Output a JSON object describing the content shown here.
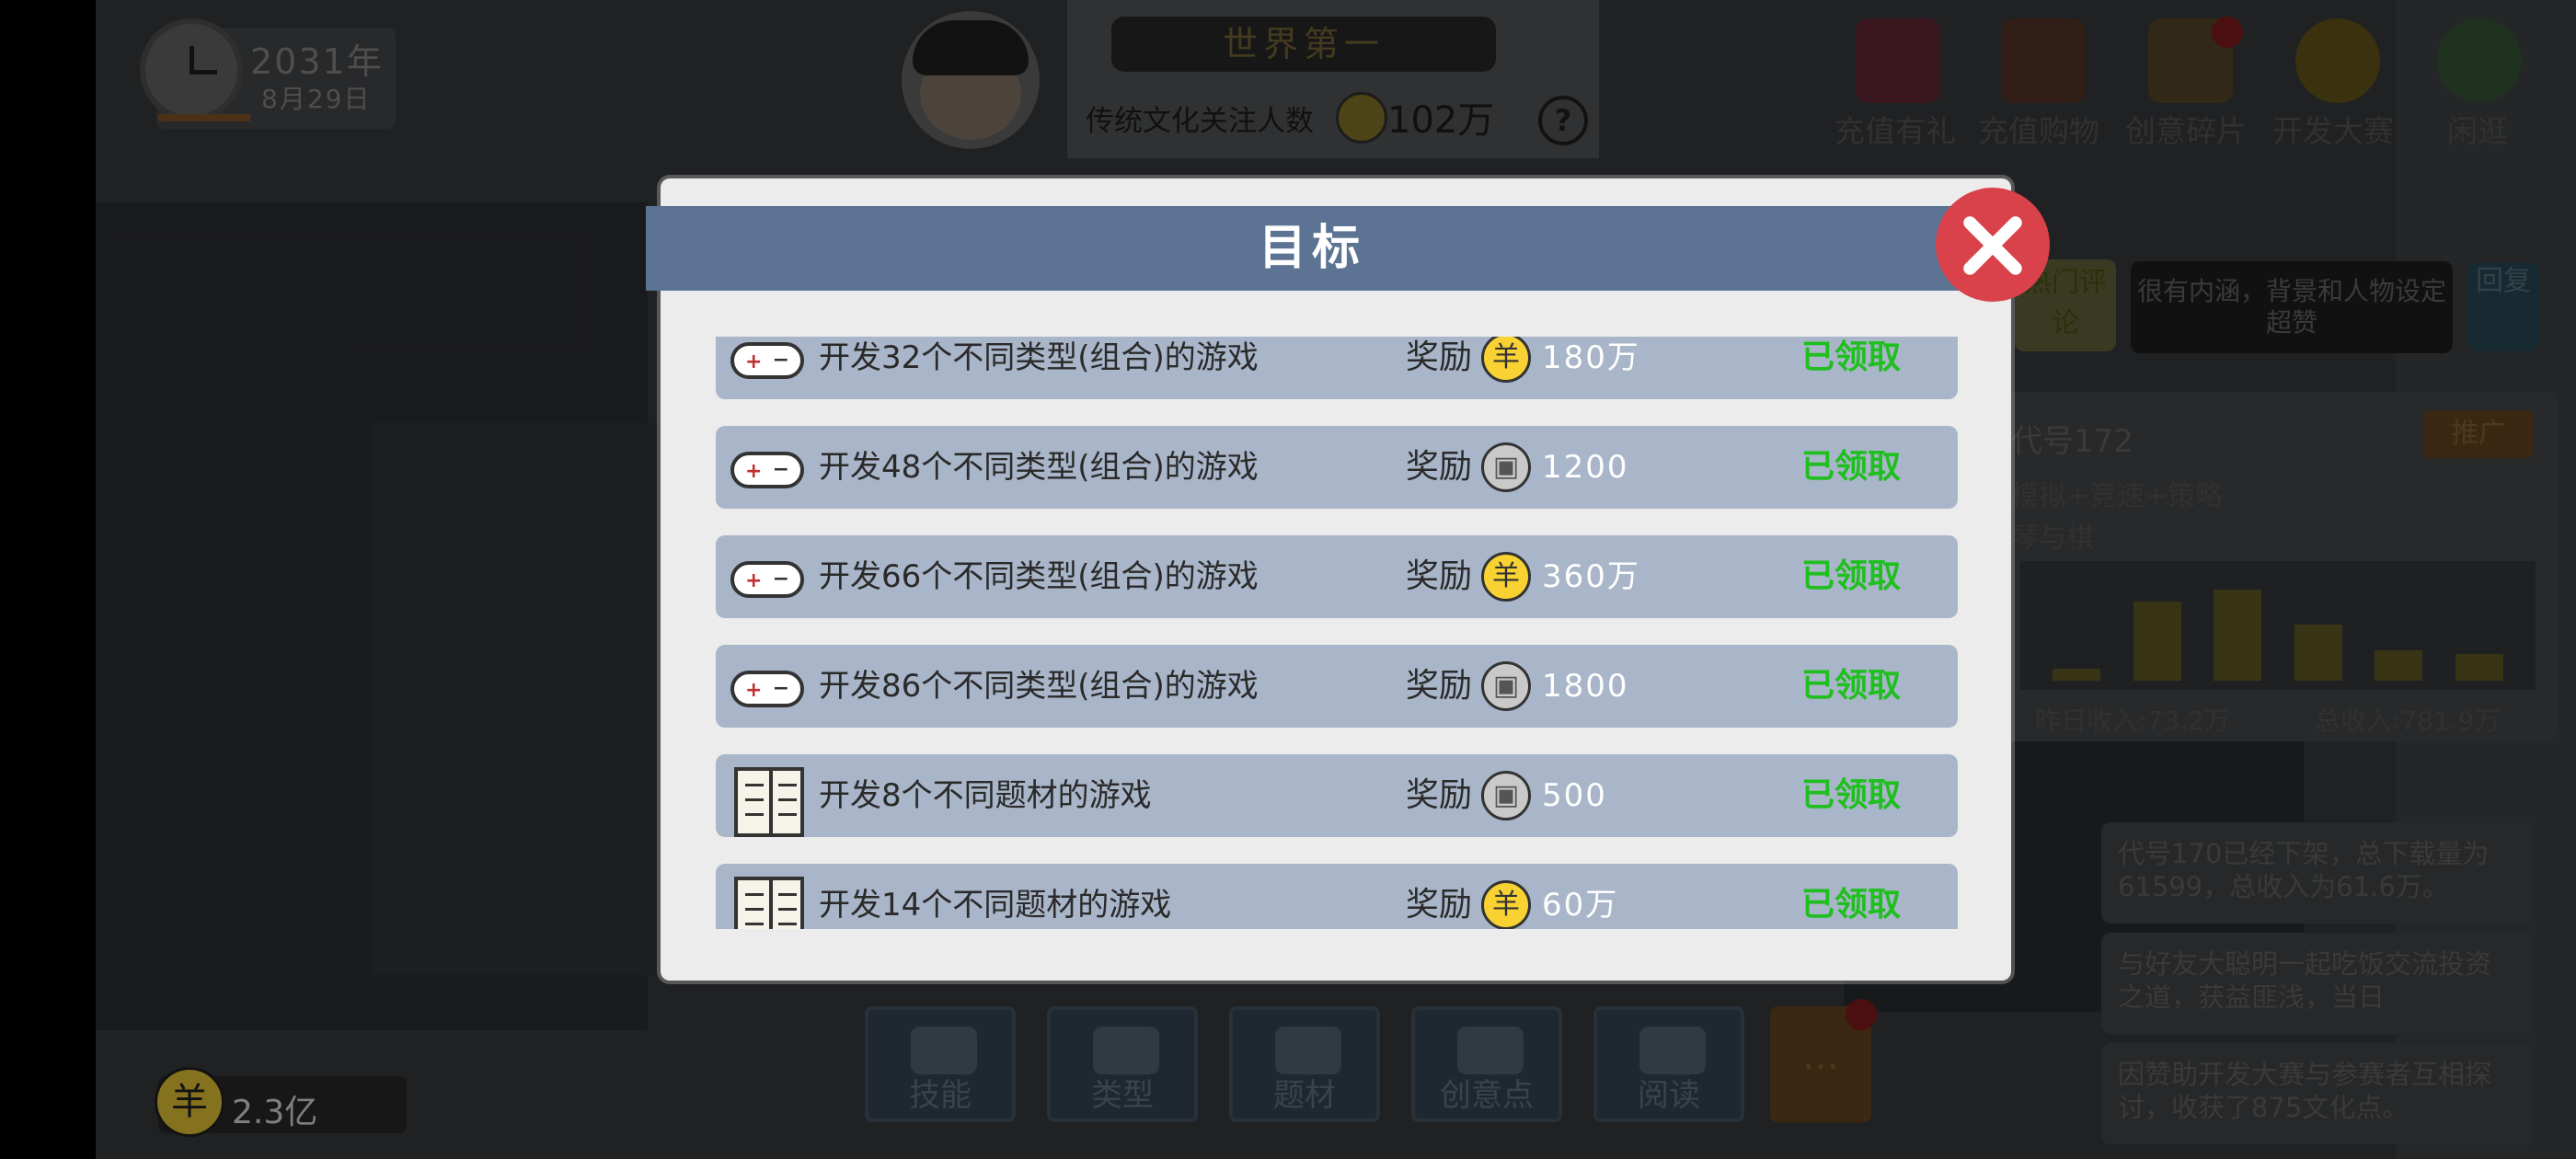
{
  "hud": {
    "year": "2031年",
    "day": "8月29日",
    "rank_title": "世界第一",
    "fans_label": "传统文化关注人数",
    "fans_count": "102万",
    "help": "?"
  },
  "top_menu": [
    {
      "label": "充值有礼",
      "icon": "gift-icon"
    },
    {
      "label": "充值购物",
      "icon": "shop-icon"
    },
    {
      "label": "创意碎片",
      "icon": "gift-box-icon"
    },
    {
      "label": "开发大赛",
      "icon": "code-medal-icon"
    },
    {
      "label": "闲逛",
      "icon": "tree-icon"
    }
  ],
  "hot_comment": {
    "tag": "热门评论",
    "text": "很有内涵，背景和人物设定超赞",
    "reply": "回复"
  },
  "game_stats": {
    "name": "代号172",
    "promote": "推广",
    "types": "模拟+竞速+策略",
    "theme": "琴与棋",
    "yesterday": "昨日收入:73.2万",
    "total": "总收入:781.9万",
    "chart_values": [
      0.12,
      0.78,
      0.9,
      0.55,
      0.3,
      0.26
    ]
  },
  "news": [
    "代号170已经下架，总下载量为61599，总收入为61.6万。",
    "与好友大聪明一起吃饭交流投资之道，获益匪浅，当日",
    "因赞助开发大赛与参赛者互相探讨，收获了875文化点。"
  ],
  "bottom_bar": [
    {
      "label": "技能",
      "icon": "book-icon"
    },
    {
      "label": "类型",
      "icon": "gamepad-icon"
    },
    {
      "label": "题材",
      "icon": "notebook-icon"
    },
    {
      "label": "创意点",
      "icon": "diamond-icon"
    },
    {
      "label": "阅读",
      "icon": "open-book-icon"
    }
  ],
  "more": "…",
  "money": {
    "coin": "羊",
    "value": "2.3亿"
  },
  "modal": {
    "title": "目标",
    "reward_label": "奖励",
    "items": [
      {
        "icon": "gamepad",
        "text": "开发32个不同类型(组合)的游戏",
        "coin": "gold",
        "coin_glyph": "羊",
        "amount": "180万",
        "status": "已领取"
      },
      {
        "icon": "gamepad",
        "text": "开发48个不同类型(组合)的游戏",
        "coin": "silver",
        "coin_glyph": "▣",
        "amount": "1200",
        "status": "已领取"
      },
      {
        "icon": "gamepad",
        "text": "开发66个不同类型(组合)的游戏",
        "coin": "gold",
        "coin_glyph": "羊",
        "amount": "360万",
        "status": "已领取"
      },
      {
        "icon": "gamepad",
        "text": "开发86个不同类型(组合)的游戏",
        "coin": "silver",
        "coin_glyph": "▣",
        "amount": "1800",
        "status": "已领取"
      },
      {
        "icon": "book",
        "text": "开发8个不同题材的游戏",
        "coin": "silver",
        "coin_glyph": "▣",
        "amount": "500",
        "status": "已领取"
      },
      {
        "icon": "book",
        "text": "开发14个不同题材的游戏",
        "coin": "gold",
        "coin_glyph": "羊",
        "amount": "60万",
        "status": "已领取"
      }
    ]
  }
}
